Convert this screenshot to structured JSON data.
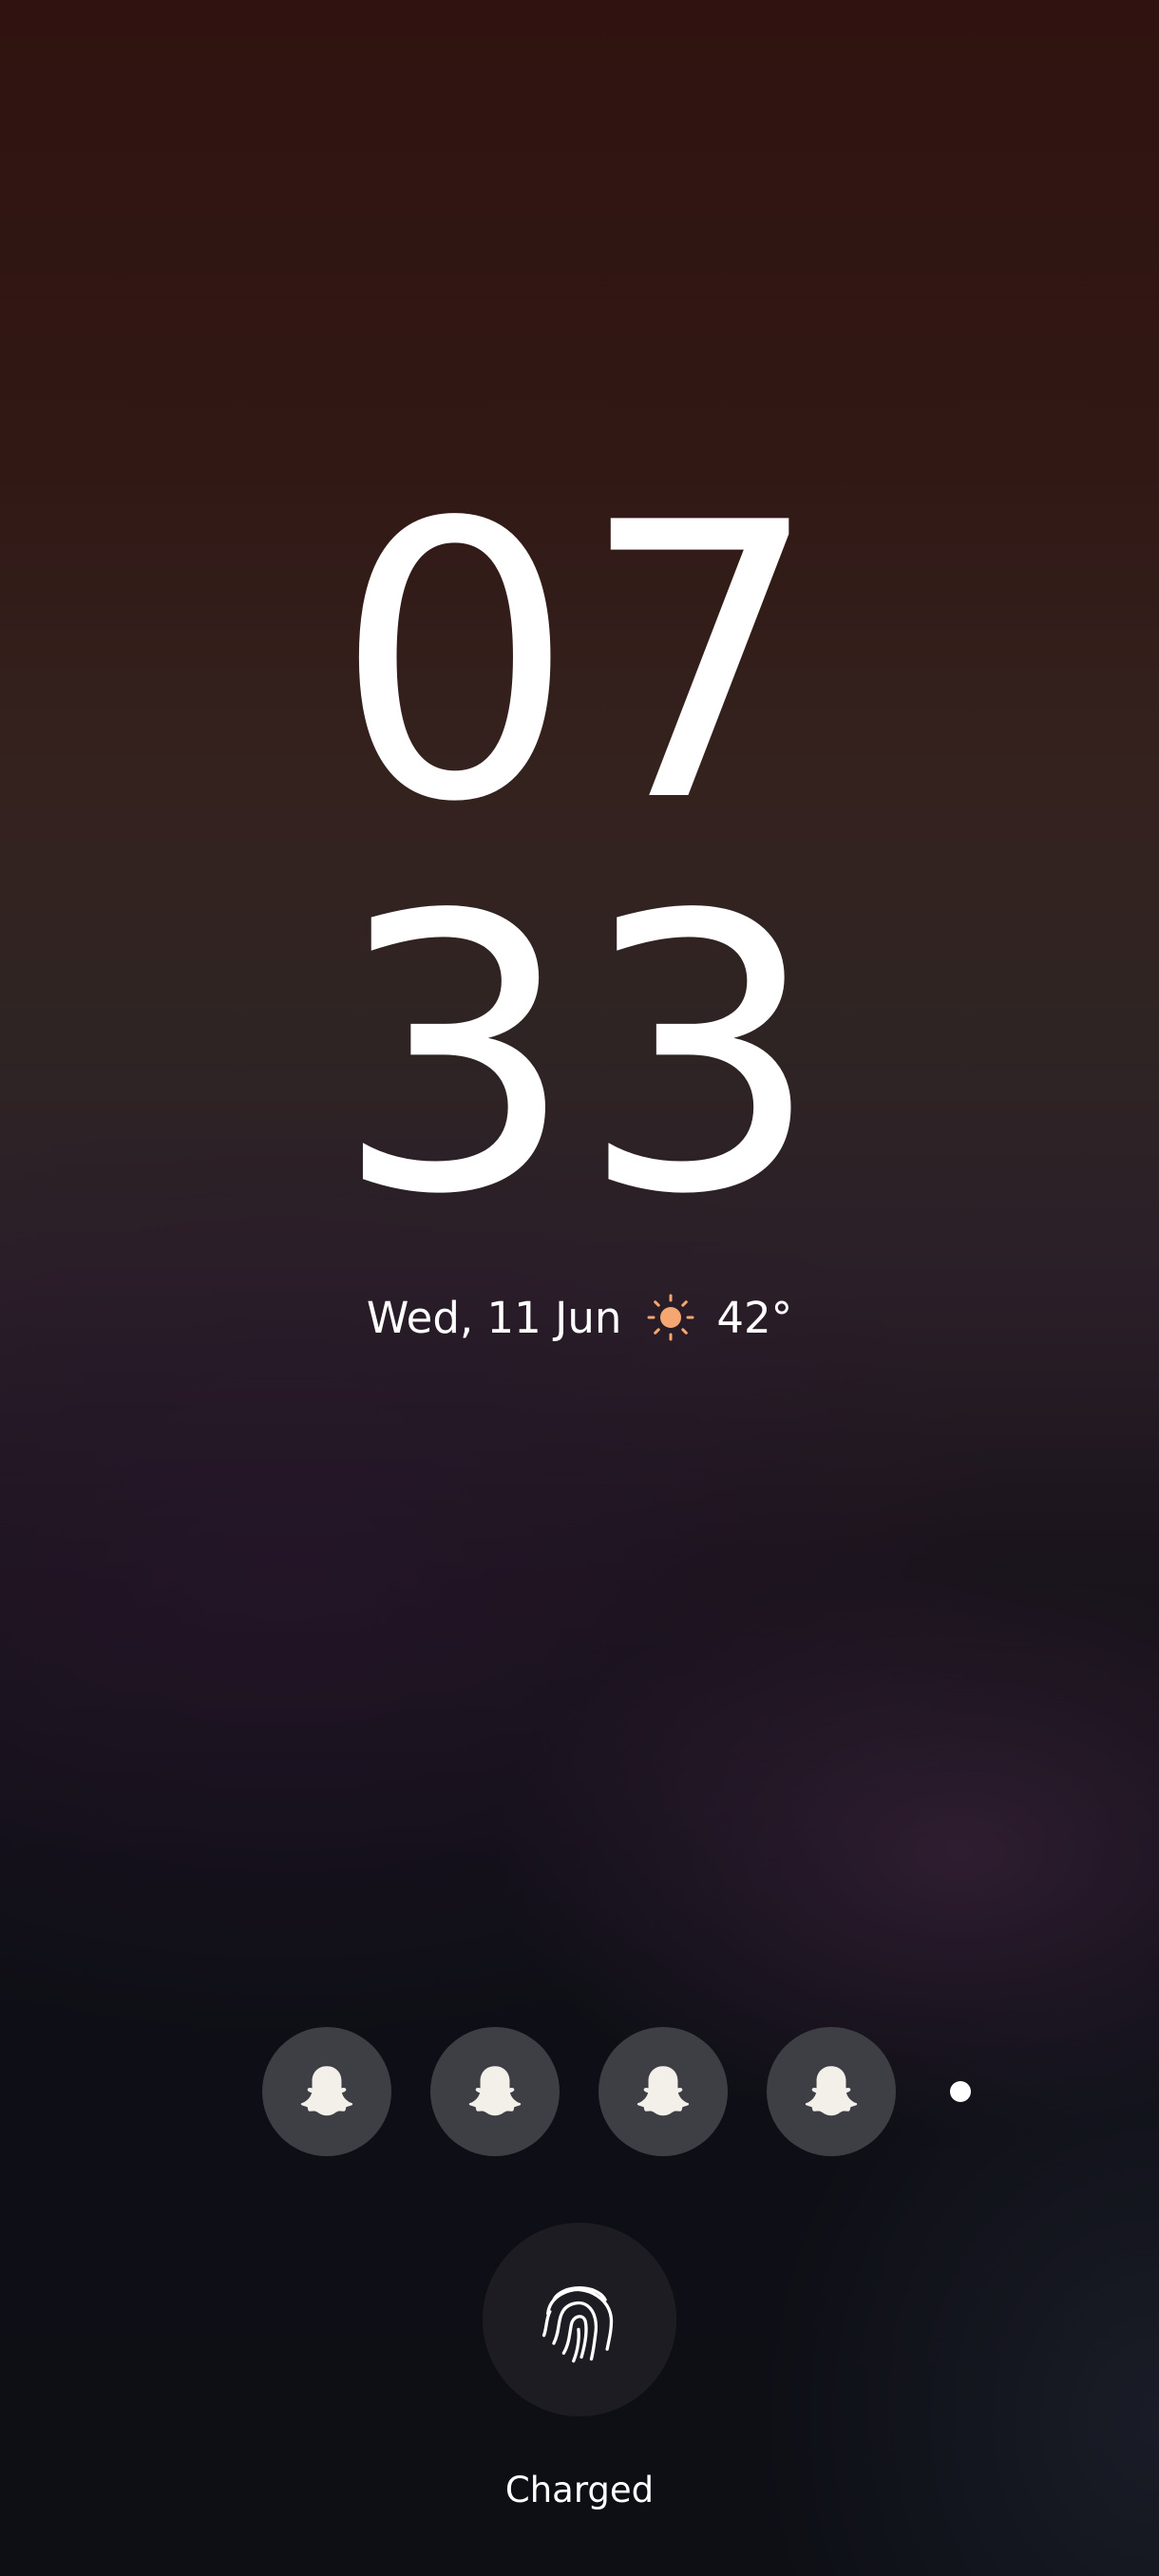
{
  "lock_screen": {
    "clock": {
      "hours": "07",
      "minutes": "33"
    },
    "date": "Wed, 11 Jun",
    "weather": {
      "icon": "sun-icon",
      "temperature": "42°",
      "icon_color": "#f6a771"
    },
    "notifications": [
      {
        "app_icon": "snapchat-ghost-icon"
      },
      {
        "app_icon": "snapchat-ghost-icon"
      },
      {
        "app_icon": "snapchat-ghost-icon"
      },
      {
        "app_icon": "snapchat-ghost-icon"
      }
    ],
    "more_notifications_indicator": "dot-icon",
    "unlock_icon": "fingerprint-icon",
    "battery_status": "Charged"
  }
}
